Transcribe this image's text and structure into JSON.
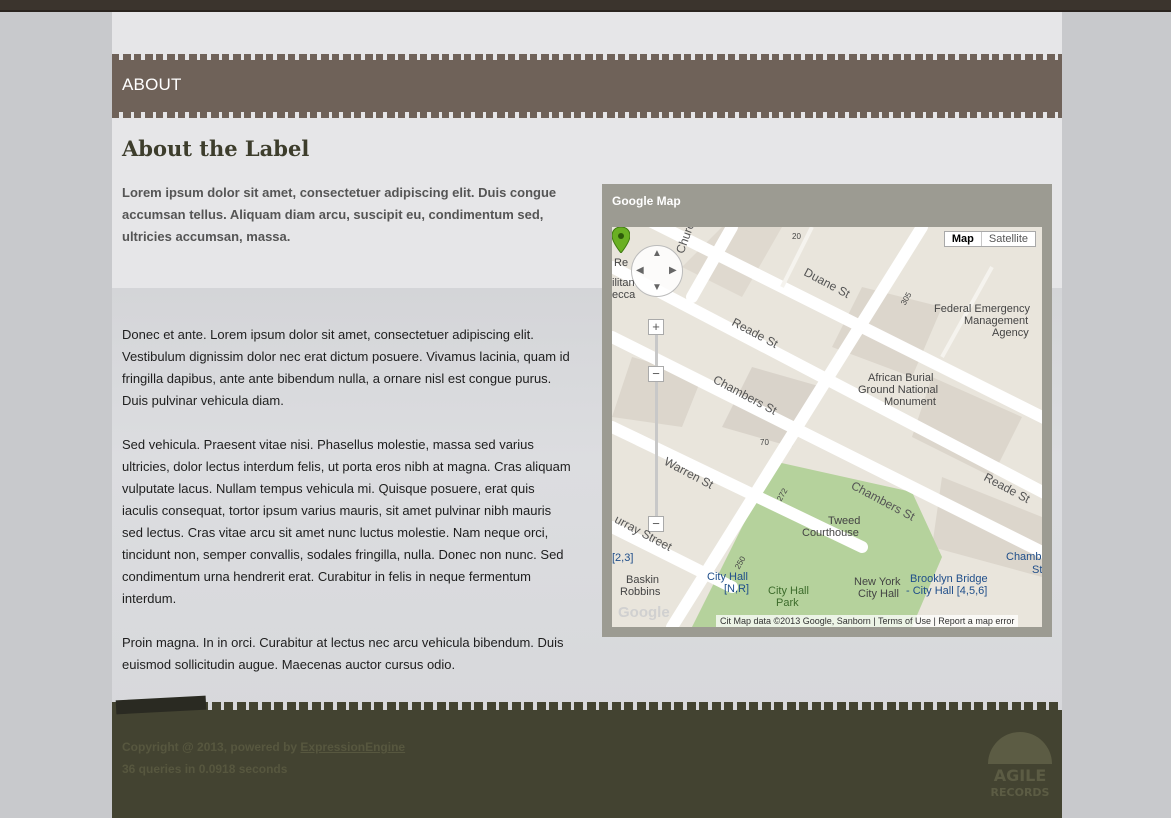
{
  "header": {
    "banner_title": "ABOUT"
  },
  "main": {
    "heading": "About the Label",
    "intro": "Lorem ipsum dolor sit amet, consectetuer adipiscing elit. Duis congue accumsan tellus. Aliquam diam arcu, suscipit eu, condimentum sed, ultricies accumsan, massa.",
    "paragraphs": [
      "Donec et ante. Lorem ipsum dolor sit amet, consectetuer adipiscing elit. Vestibulum dignissim dolor nec erat dictum posuere. Vivamus lacinia, quam id fringilla dapibus, ante ante bibendum nulla, a ornare nisl est congue purus. Duis pulvinar vehicula diam.",
      "Sed vehicula. Praesent vitae nisi. Phasellus molestie, massa sed varius ultricies, dolor lectus interdum felis, ut porta eros nibh at magna. Cras aliquam vulputate lacus. Nullam tempus vehicula mi. Quisque posuere, erat quis iaculis consequat, tortor ipsum varius mauris, sit amet pulvinar nibh mauris sed lectus. Cras vitae arcu sit amet nunc luctus molestie. Nam neque orci, tincidunt non, semper convallis, sodales fringilla, nulla. Donec non nunc. Sed condimentum urna hendrerit erat. Curabitur in felis in neque fermentum interdum.",
      "Proin magna. In in orci. Curabitur at lectus nec arcu vehicula bibendum. Duis euismod sollicitudin augue. Maecenas auctor cursus odio."
    ]
  },
  "map": {
    "title": "Google Map",
    "type_map": "Map",
    "type_satellite": "Satellite",
    "zoom_in": "+",
    "zoom_out": "−",
    "labels": {
      "church_st": "Church St",
      "duane_st": "Duane St",
      "reade_st": "Reade St",
      "reade_st_2": "Reade St",
      "chambers_st": "Chambers St",
      "chambers_st_2": "Chambers St",
      "chambers_st_3": "Chamb",
      "chambers_st_3b": "St",
      "warren_st": "Warren St",
      "murray_st": "urray Street",
      "fema": "Federal Emergency",
      "fema2": "Management",
      "fema3": "Agency",
      "burial": "African Burial",
      "burial2": "Ground National",
      "burial3": "Monument",
      "tweed": "Tweed",
      "tweed2": "Courthouse",
      "city_hall_park": "City Hall",
      "city_hall_park2": "Park",
      "ny_city_hall": "New York",
      "ny_city_hall2": "City Hall",
      "city_hall_station": "City Hall",
      "city_hall_station2": "[N,R]",
      "brooklyn_bridge": "Brooklyn Bridge",
      "brooklyn_bridge2": "- City Hall [4,5,6]",
      "baskin": "Baskin",
      "baskin2": "Robbins",
      "line23": "[2,3]",
      "edge_re": "Re",
      "edge_ilt": "ilitan",
      "edge_eca": "ecca",
      "num_305": "305",
      "num_70": "70",
      "num_272": "272",
      "num_250": "250",
      "num_20": "20",
      "google": "Google",
      "citi": "Cit"
    },
    "attribution": {
      "data": "Map data ©2013 Google, Sanborn",
      "terms": "Terms of Use",
      "report": "Report a map error"
    }
  },
  "footer": {
    "copyright": "Copyright @ 2013, powered by ",
    "engine_link": "ExpressionEngine",
    "queries": "36 queries in 0.0918 seconds",
    "logo_line1": "AGILE",
    "logo_line2": "RECORDS"
  }
}
